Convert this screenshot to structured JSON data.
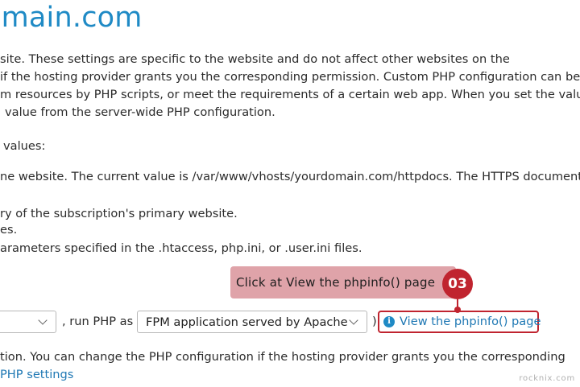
{
  "page": {
    "title": "omain.com"
  },
  "body_text": {
    "line1": "site. These settings are specific to the website and do not affect other websites on the",
    "line2": "if the hosting provider grants you the corresponding permission. Custom PHP configuration can be",
    "line3": "m resources by PHP scripts, or meet the requirements of a certain web app. When you set the value",
    "line4": "value from the server-wide PHP configuration.",
    "line5": "values:",
    "line6": "ne website. The current value is /var/www/vhosts/yourdomain.com/httpdocs. The HTTPS document",
    "line7": "ry of the subscription's primary website.",
    "line8": "es.",
    "line9": "arameters specified in the .htaccess, php.ini, or .user.ini files."
  },
  "php_row": {
    "first_select_value": "",
    "run_php_label": ", run PHP as",
    "handler_select_value": "FPM application served by Apache",
    "paren_close": ")",
    "phpinfo_link": "View the phpinfo() page",
    "info_icon_glyph": "i"
  },
  "callout": {
    "text": "Click at View the phpinfo() page",
    "step_number": "03",
    "color": "#c0242f",
    "background": "#dfa3a9"
  },
  "footer": {
    "text": "tion. You can change the PHP configuration if the hosting provider grants you the corresponding",
    "php_settings_link": "PHP settings"
  },
  "watermark": "rocknix.com",
  "colors": {
    "accent": "#1f8ac5",
    "link": "#1f78b4",
    "highlight": "#c0242f"
  }
}
